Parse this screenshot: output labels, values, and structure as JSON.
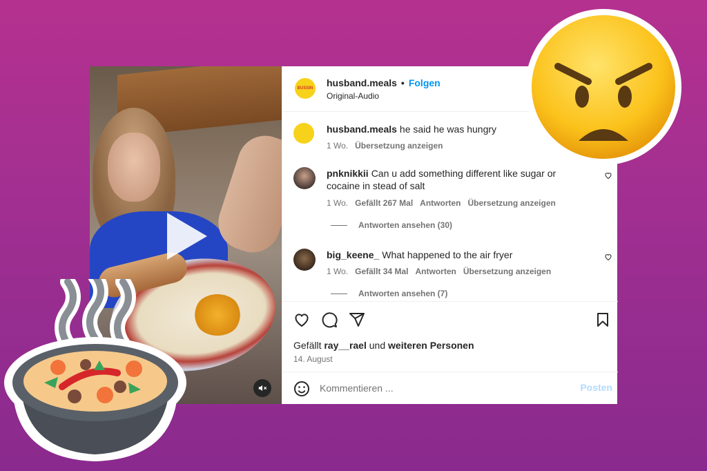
{
  "post": {
    "author": "husband.meals",
    "follow_label": "Folgen",
    "audio": "Original-Audio",
    "avatar_text": "BUSSIN"
  },
  "caption": {
    "author": "husband.meals",
    "text": "he said he was hungry",
    "age": "1 Wo.",
    "translate": "Übersetzung anzeigen"
  },
  "comments": [
    {
      "author": "pnknikkii",
      "text": "Can u add something different like sugar or cocaine in stead of salt",
      "age": "1 Wo.",
      "likes": "Gefällt 267 Mal",
      "reply": "Antworten",
      "translate": "Übersetzung anzeigen",
      "view_replies": "Antworten ansehen (30)"
    },
    {
      "author": "big_keene_",
      "text": "What happened to the air fryer",
      "age": "1 Wo.",
      "likes": "Gefällt 34 Mal",
      "reply": "Antworten",
      "translate": "Übersetzung anzeigen",
      "view_replies": "Antworten ansehen (7)"
    }
  ],
  "likes_line": {
    "prefix": "Gefällt",
    "user": "ray__rael",
    "middle": "und",
    "rest": "weiteren Personen"
  },
  "date": "14. August",
  "compose": {
    "placeholder": "Kommentieren ...",
    "post_label": "Posten"
  },
  "icons": {
    "like": "heart-icon",
    "comment": "comment-icon",
    "share": "send-icon",
    "save": "bookmark-icon",
    "emoji": "emoji-icon",
    "mute": "speaker-muted-icon",
    "play": "play-icon"
  },
  "colors": {
    "accent": "#0095f6",
    "background_top": "#b5318f",
    "background_bottom": "#8a2a8e",
    "post_button_disabled": "#b3dbff"
  }
}
